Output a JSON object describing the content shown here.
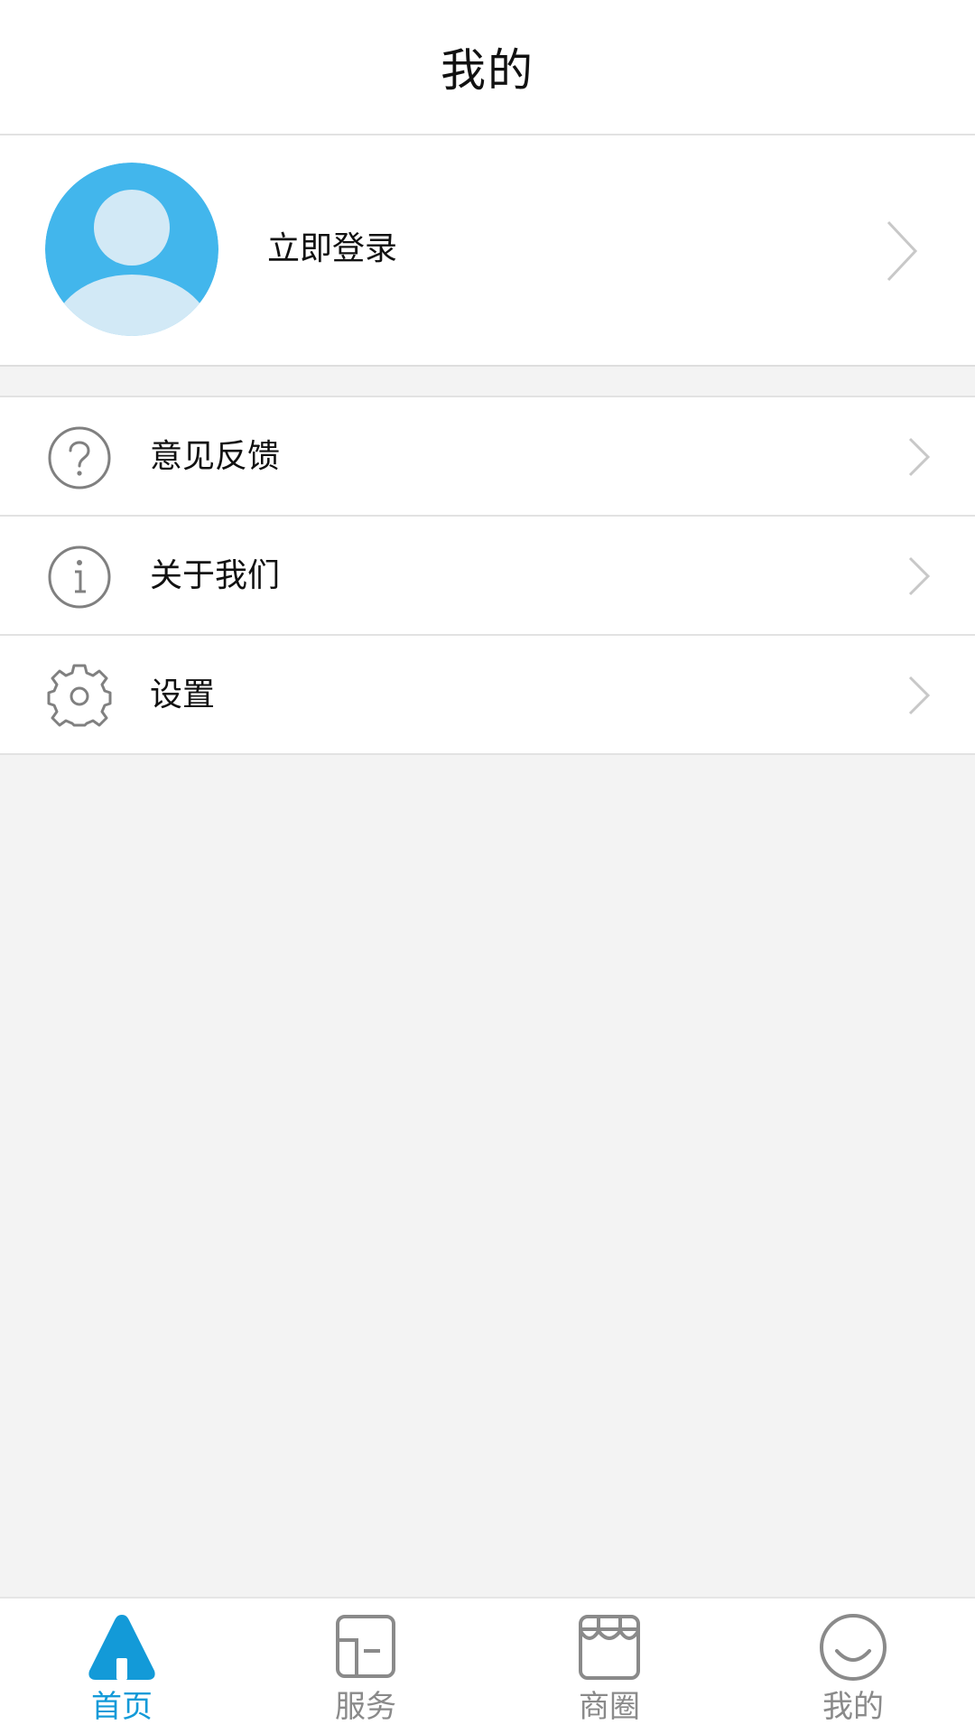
{
  "header": {
    "title": "我的"
  },
  "profile": {
    "login_label": "立即登录",
    "avatar_icon": "user-avatar-icon",
    "chevron_icon": "chevron-right-icon"
  },
  "menu": {
    "items": [
      {
        "label": "意见反馈",
        "icon": "question-circle-icon"
      },
      {
        "label": "关于我们",
        "icon": "info-circle-icon"
      },
      {
        "label": "设置",
        "icon": "gear-icon"
      }
    ]
  },
  "tabbar": {
    "tabs": [
      {
        "label": "首页",
        "icon": "home-icon",
        "active": true
      },
      {
        "label": "服务",
        "icon": "service-icon",
        "active": false
      },
      {
        "label": "商圈",
        "icon": "store-icon",
        "active": false
      },
      {
        "label": "我的",
        "icon": "smile-icon",
        "active": false
      }
    ]
  },
  "colors": {
    "accent": "#139ad8",
    "avatar_bg": "#42b6ec",
    "avatar_fg": "#d2e9f6",
    "inactive": "#8a8a8a",
    "page_bg": "#f3f3f3"
  }
}
